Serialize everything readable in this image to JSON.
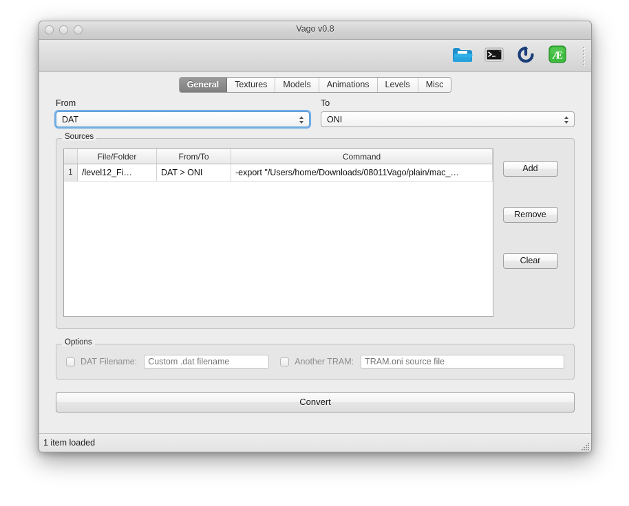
{
  "window": {
    "title": "Vago v0.8",
    "traffic_lights": [
      "close",
      "minimize",
      "zoom"
    ]
  },
  "toolbar": {
    "items": [
      {
        "name": "open-folder-icon",
        "label": "Open folder"
      },
      {
        "name": "terminal-icon",
        "label": "Terminal"
      },
      {
        "name": "reload-icon",
        "label": "Reload"
      },
      {
        "name": "ae-icon",
        "label": "Æ"
      }
    ]
  },
  "tabs": [
    {
      "label": "General",
      "active": true
    },
    {
      "label": "Textures",
      "active": false
    },
    {
      "label": "Models",
      "active": false
    },
    {
      "label": "Animations",
      "active": false
    },
    {
      "label": "Levels",
      "active": false
    },
    {
      "label": "Misc",
      "active": false
    }
  ],
  "fields": {
    "from_label": "From",
    "from_value": "DAT",
    "to_label": "To",
    "to_value": "ONI"
  },
  "sources": {
    "title": "Sources",
    "columns": [
      "",
      "File/Folder",
      "From/To",
      "Command"
    ],
    "rows": [
      {
        "index": "1",
        "file": "/level12_Fi…",
        "fromto": "DAT > ONI",
        "command": "-export \"/Users/home/Downloads/08011Vago/plain/mac_…"
      }
    ],
    "buttons": {
      "add": "Add",
      "remove": "Remove",
      "clear": "Clear"
    }
  },
  "options": {
    "title": "Options",
    "dat_filename_label": "DAT Filename:",
    "dat_filename_placeholder": "Custom .dat filename",
    "dat_filename_value": "",
    "another_tram_label": "Another TRAM:",
    "another_tram_placeholder": "TRAM.oni source file",
    "another_tram_value": ""
  },
  "convert_button": "Convert",
  "status": "1 item loaded",
  "colors": {
    "folder_blue": "#1e90c8",
    "reload_blue": "#1b3f78",
    "ae_green": "#3dbb3d",
    "focus_blue": "#72aee6",
    "window_bg": "#ededed",
    "active_tab": "#8a8a8a"
  }
}
